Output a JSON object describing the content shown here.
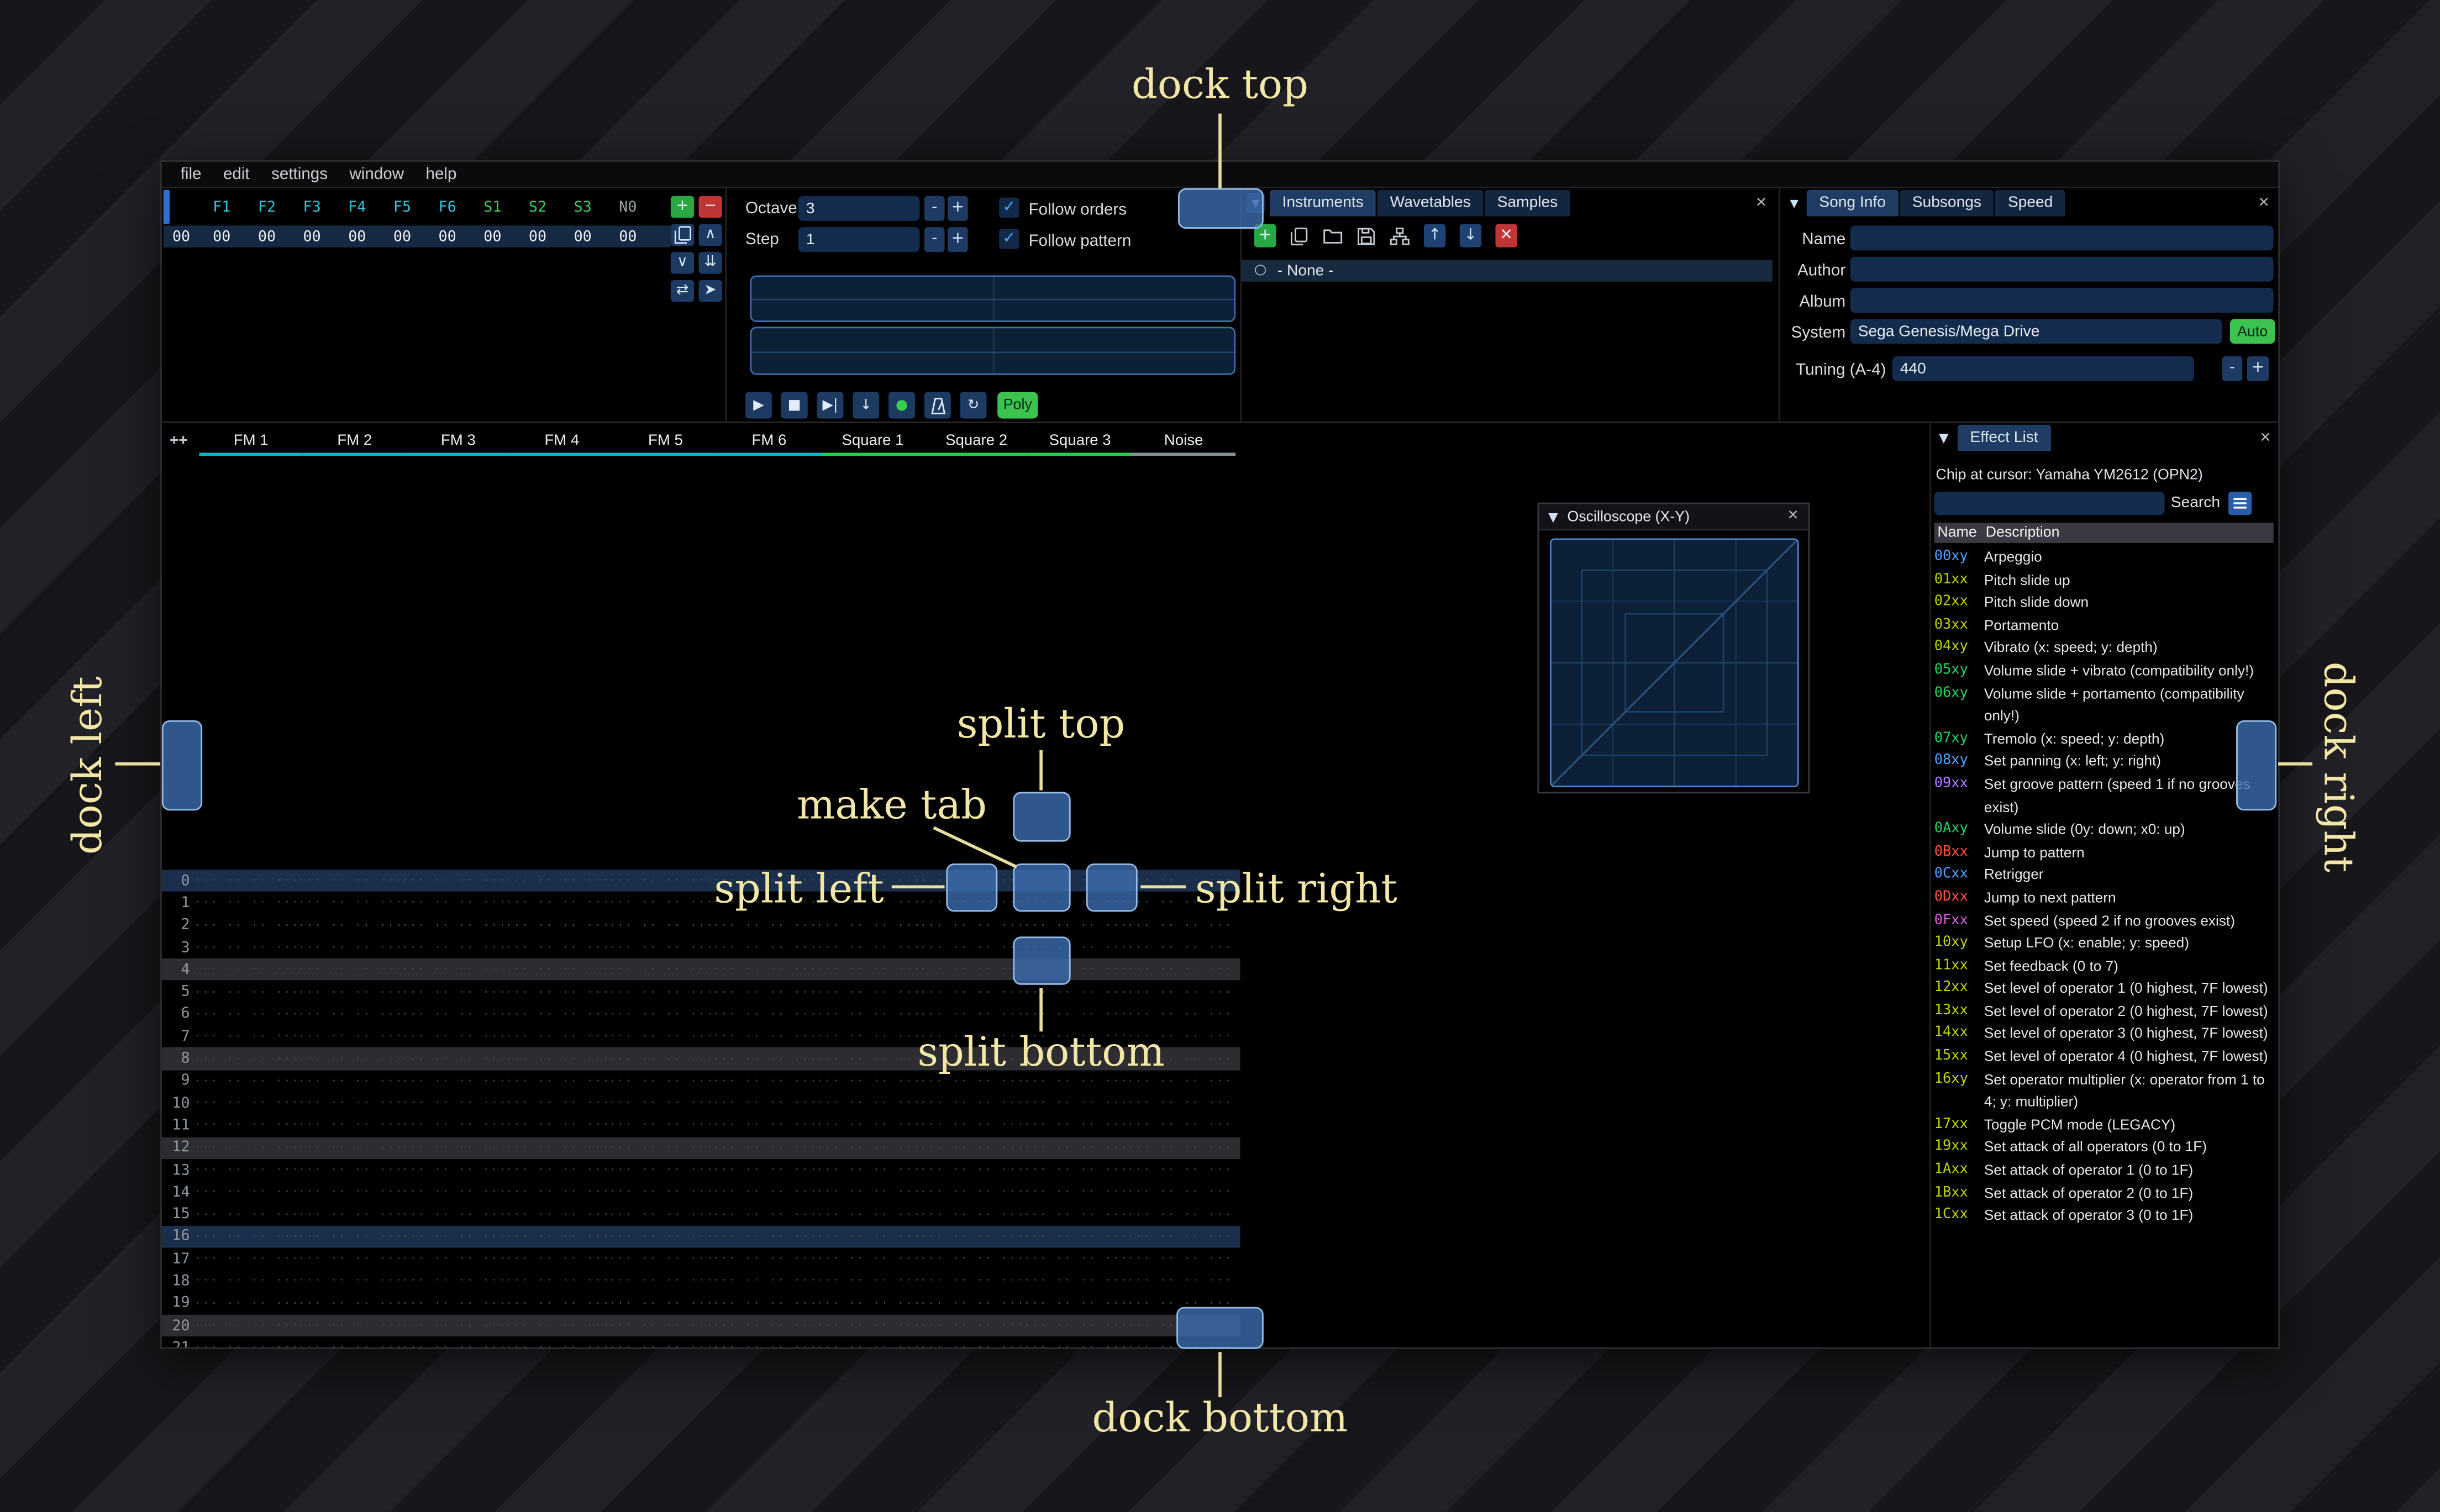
{
  "menu": {
    "items": [
      "file",
      "edit",
      "settings",
      "window",
      "help"
    ]
  },
  "icons": {
    "collapse": "▼",
    "dropdown": "▼",
    "close": "✕",
    "check": "✓",
    "none_bullet": "○",
    "minus": "-",
    "plus": "+"
  },
  "orders": {
    "columns": [
      {
        "label": "F1",
        "color": "#2ec7dd"
      },
      {
        "label": "F2",
        "color": "#2ec7dd"
      },
      {
        "label": "F3",
        "color": "#2ec7dd"
      },
      {
        "label": "F4",
        "color": "#2ec7dd"
      },
      {
        "label": "F5",
        "color": "#2ec7dd"
      },
      {
        "label": "F6",
        "color": "#2ec7dd"
      },
      {
        "label": "S1",
        "color": "#35d26a"
      },
      {
        "label": "S2",
        "color": "#35d26a"
      },
      {
        "label": "S3",
        "color": "#35d26a"
      },
      {
        "label": "N0",
        "color": "#9aa59d"
      }
    ],
    "row_index": "00",
    "row_values": [
      "00",
      "00",
      "00",
      "00",
      "00",
      "00",
      "00",
      "00",
      "00",
      "00"
    ],
    "buttons": [
      {
        "name": "add",
        "glyph": "+",
        "style": "green"
      },
      {
        "name": "remove",
        "glyph": "−",
        "style": "red"
      },
      {
        "name": "duplicate",
        "icon": "clone"
      },
      {
        "name": "move-up",
        "glyph": "∧"
      },
      {
        "name": "move-down",
        "glyph": "∨"
      },
      {
        "name": "duplicate-to-end",
        "glyph": "⇊"
      },
      {
        "name": "change-all",
        "glyph": "⇄"
      },
      {
        "name": "edit-mode",
        "glyph": "➤"
      }
    ]
  },
  "play_controls": {
    "octave_label": "Octave",
    "octave_value": "3",
    "step_label": "Step",
    "step_value": "1",
    "follow_orders_label": "Follow orders",
    "follow_pattern_label": "Follow pattern",
    "transport": [
      {
        "name": "play",
        "glyph": "▶"
      },
      {
        "name": "stop",
        "glyph": "■"
      },
      {
        "name": "play-from-cursor",
        "glyph": "▶|"
      },
      {
        "name": "step-row",
        "glyph": "↓"
      },
      {
        "name": "record",
        "glyph": "●",
        "color": "#35d04f"
      },
      {
        "name": "metronome",
        "icon": "metronome"
      },
      {
        "name": "repeat-pattern",
        "glyph": "↻"
      }
    ],
    "poly_label": "Poly"
  },
  "instruments": {
    "tabs": [
      "Instruments",
      "Wavetables",
      "Samples"
    ],
    "active_tab": "Instruments",
    "toolbar": [
      {
        "name": "add",
        "glyph": "+",
        "style": "green"
      },
      {
        "name": "clone",
        "icon": "clone"
      },
      {
        "name": "open",
        "icon": "folder"
      },
      {
        "name": "save",
        "icon": "floppy"
      },
      {
        "name": "toggle-folders",
        "icon": "sitemap"
      },
      {
        "name": "move-up",
        "glyph": "↑",
        "style": "navy"
      },
      {
        "name": "move-down",
        "glyph": "↓",
        "style": "navy"
      },
      {
        "name": "delete",
        "glyph": "✕",
        "style": "red"
      }
    ],
    "items": [
      {
        "label": "- None -",
        "selected": true
      }
    ]
  },
  "song_info": {
    "tabs": [
      "Song Info",
      "Subsongs",
      "Speed"
    ],
    "active_tab": "Song Info",
    "name_label": "Name",
    "name_value": "",
    "author_label": "Author",
    "author_value": "",
    "album_label": "Album",
    "album_value": "",
    "system_label": "System",
    "system_value": "Sega Genesis/Mega Drive",
    "auto_label": "Auto",
    "tuning_label": "Tuning (A-4)",
    "tuning_value": "440"
  },
  "pattern": {
    "add_channel_label": "++",
    "channels": [
      {
        "name": "FM 1",
        "color": "#00b8cc"
      },
      {
        "name": "FM 2",
        "color": "#00b8cc"
      },
      {
        "name": "FM 3",
        "color": "#00b8cc"
      },
      {
        "name": "FM 4",
        "color": "#00b8cc"
      },
      {
        "name": "FM 5",
        "color": "#00b8cc"
      },
      {
        "name": "FM 6",
        "color": "#00b8cc"
      },
      {
        "name": "Square 1",
        "color": "#1fcf4f"
      },
      {
        "name": "Square 2",
        "color": "#1fcf4f"
      },
      {
        "name": "Square 3",
        "color": "#1fcf4f"
      },
      {
        "name": "Noise",
        "color": "#8a9296"
      }
    ],
    "row_count": 22,
    "highlight_major": [
      0,
      16
    ],
    "highlight_minor": [
      4,
      8,
      12,
      20
    ],
    "empty_cell": "··· ·· ·· ···"
  },
  "oscilloscope": {
    "title": "Oscilloscope (X-Y)"
  },
  "effect_list": {
    "tab_label": "Effect List",
    "chip_label": "Chip at cursor: Yamaha YM2612 (OPN2)",
    "search_label": "Search",
    "search_value": "",
    "name_column": "Name",
    "description_column": "Description",
    "effects": [
      {
        "code": "00xy",
        "color": "#4ba2ff",
        "desc": "Arpeggio"
      },
      {
        "code": "01xx",
        "color": "#bfd000",
        "desc": "Pitch slide up"
      },
      {
        "code": "02xx",
        "color": "#bfd000",
        "desc": "Pitch slide down"
      },
      {
        "code": "03xx",
        "color": "#bfd000",
        "desc": "Portamento"
      },
      {
        "code": "04xy",
        "color": "#bfd000",
        "desc": "Vibrato (x: speed; y: depth)"
      },
      {
        "code": "05xy",
        "color": "#20d460",
        "desc": "Volume slide + vibrato (compatibility only!)"
      },
      {
        "code": "06xy",
        "color": "#20d460",
        "desc": "Volume slide + portamento (compatibility only!)"
      },
      {
        "code": "07xy",
        "color": "#20d460",
        "desc": "Tremolo (x: speed; y: depth)"
      },
      {
        "code": "08xy",
        "color": "#4ba2ff",
        "desc": "Set panning (x: left; y: right)"
      },
      {
        "code": "09xx",
        "color": "#b27aff",
        "desc": "Set groove pattern (speed 1 if no grooves exist)"
      },
      {
        "code": "0Axy",
        "color": "#20d460",
        "desc": "Volume slide (0y: down; x0: up)"
      },
      {
        "code": "0Bxx",
        "color": "#ff5038",
        "desc": "Jump to pattern"
      },
      {
        "code": "0Cxx",
        "color": "#4ba2ff",
        "desc": "Retrigger"
      },
      {
        "code": "0Dxx",
        "color": "#ff5038",
        "desc": "Jump to next pattern"
      },
      {
        "code": "0Fxx",
        "color": "#e05ce0",
        "desc": "Set speed (speed 2 if no grooves exist)"
      },
      {
        "code": "10xy",
        "color": "#bfd000",
        "desc": "Setup LFO (x: enable; y: speed)"
      },
      {
        "code": "11xx",
        "color": "#bfd000",
        "desc": "Set feedback (0 to 7)"
      },
      {
        "code": "12xx",
        "color": "#bfd000",
        "desc": "Set level of operator 1 (0 highest, 7F lowest)"
      },
      {
        "code": "13xx",
        "color": "#bfd000",
        "desc": "Set level of operator 2 (0 highest, 7F lowest)"
      },
      {
        "code": "14xx",
        "color": "#bfd000",
        "desc": "Set level of operator 3 (0 highest, 7F lowest)"
      },
      {
        "code": "15xx",
        "color": "#bfd000",
        "desc": "Set level of operator 4 (0 highest, 7F lowest)"
      },
      {
        "code": "16xy",
        "color": "#bfd000",
        "desc": "Set operator multiplier (x: operator from 1 to 4; y: multiplier)"
      },
      {
        "code": "17xx",
        "color": "#bfd000",
        "desc": "Toggle PCM mode (LEGACY)"
      },
      {
        "code": "19xx",
        "color": "#bfd000",
        "desc": "Set attack of all operators (0 to 1F)"
      },
      {
        "code": "1Axx",
        "color": "#bfd000",
        "desc": "Set attack of operator 1 (0 to 1F)"
      },
      {
        "code": "1Bxx",
        "color": "#bfd000",
        "desc": "Set attack of operator 2 (0 to 1F)"
      },
      {
        "code": "1Cxx",
        "color": "#bfd000",
        "desc": "Set attack of operator 3 (0 to 1F)"
      }
    ]
  },
  "dock_overlay": {
    "dock_top": "dock top",
    "dock_bottom": "dock bottom",
    "dock_left": "dock left",
    "dock_right": "dock right",
    "split_top": "split top",
    "split_bottom": "split bottom",
    "split_left": "split left",
    "split_right": "split right",
    "make_tab": "make tab",
    "accent_color": "#4a7fc1",
    "label_color": "#f2e7a6"
  }
}
